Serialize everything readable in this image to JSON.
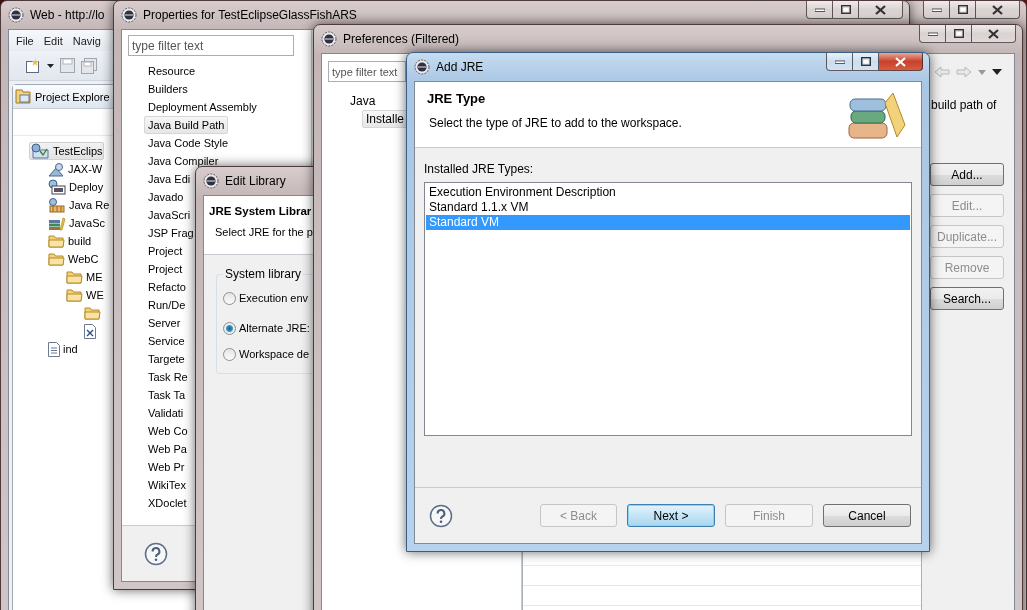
{
  "main_window": {
    "title": "Web - http://lo",
    "menu": [
      "File",
      "Edit",
      "Navig"
    ],
    "view_title": "Project Explore",
    "tree": [
      {
        "label": "TestEclips",
        "kind": "project",
        "selected": true,
        "children": [
          {
            "label": "JAX-W",
            "kind": "service",
            "selected": false
          },
          {
            "label": "Deploy",
            "kind": "deploy",
            "selected": false
          },
          {
            "label": "Java Re",
            "kind": "library",
            "selected": false
          },
          {
            "label": "JavaSc",
            "kind": "jslib",
            "selected": false
          },
          {
            "label": "build",
            "kind": "folder",
            "selected": false
          },
          {
            "label": "WebC",
            "kind": "folder",
            "selected": false,
            "children": [
              {
                "label": "ME",
                "kind": "folder",
                "selected": false
              },
              {
                "label": "WE",
                "kind": "folder",
                "selected": false,
                "children": [
                  {
                    "kind": "folder",
                    "selected": false
                  },
                  {
                    "kind": "xml",
                    "selected": false
                  }
                ]
              }
            ]
          },
          {
            "label": "ind",
            "kind": "file",
            "selected": false
          }
        ]
      }
    ]
  },
  "properties_window": {
    "title": "Properties for TestEclipseGlassFishARS",
    "filter_placeholder": "type filter text",
    "pages": [
      {
        "label": "Resource",
        "selected": false
      },
      {
        "label": "Builders",
        "selected": false
      },
      {
        "label": "Deployment Assembly",
        "selected": false
      },
      {
        "label": "Java Build Path",
        "selected": true
      },
      {
        "label": "Java Code Style",
        "selected": false
      },
      {
        "label": "Java Compiler",
        "selected": false
      },
      {
        "label": "Java Edi",
        "selected": false
      },
      {
        "label": "Javado",
        "selected": false
      },
      {
        "label": "JavaScri",
        "selected": false
      },
      {
        "label": "JSP Frag",
        "selected": false
      },
      {
        "label": "Project",
        "selected": false
      },
      {
        "label": "Project",
        "selected": false
      },
      {
        "label": "Refacto",
        "selected": false
      },
      {
        "label": "Run/De",
        "selected": false
      },
      {
        "label": "Server",
        "selected": false
      },
      {
        "label": "Service",
        "selected": false
      },
      {
        "label": "Targete",
        "selected": false
      },
      {
        "label": "Task Re",
        "selected": false
      },
      {
        "label": "Task Ta",
        "selected": false
      },
      {
        "label": "Validati",
        "selected": false
      },
      {
        "label": "Web Co",
        "selected": false
      },
      {
        "label": "Web Pa",
        "selected": false
      },
      {
        "label": "Web Pr",
        "selected": false
      },
      {
        "label": "WikiTex",
        "selected": false
      },
      {
        "label": "XDoclet",
        "selected": false
      }
    ]
  },
  "edit_library": {
    "title": "Edit Library",
    "heading": "JRE System Librar",
    "description": "Select JRE for the p",
    "group_label": "System library",
    "options": [
      {
        "label": "Execution env",
        "selected": false
      },
      {
        "label": "Alternate JRE:",
        "selected": true
      },
      {
        "label": "Workspace de",
        "selected": false
      }
    ]
  },
  "preferences": {
    "title": "Preferences (Filtered)",
    "filter_placeholder": "type filter text",
    "tree": [
      {
        "label": "Java",
        "selected": false,
        "children": [
          {
            "label": "Installe",
            "selected": true
          }
        ]
      }
    ],
    "description": "build path of",
    "buttons": [
      {
        "label": "Add...",
        "disabled": false
      },
      {
        "label": "Edit...",
        "disabled": true
      },
      {
        "label": "Duplicate...",
        "disabled": true
      },
      {
        "label": "Remove",
        "disabled": true
      },
      {
        "label": "Search...",
        "disabled": false
      }
    ]
  },
  "add_jre": {
    "title": "Add JRE",
    "heading": "JRE Type",
    "description": "Select the type of JRE to add to the workspace.",
    "list_label": "Installed JRE Types:",
    "jre_types": [
      {
        "label": "Execution Environment Description",
        "selected": false
      },
      {
        "label": "Standard 1.1.x VM",
        "selected": false
      },
      {
        "label": "Standard VM",
        "selected": true
      }
    ],
    "buttons": [
      {
        "label": "< Back",
        "disabled": true,
        "default": false
      },
      {
        "label": "Next >",
        "disabled": false,
        "default": true
      },
      {
        "label": "Finish",
        "disabled": true,
        "default": false
      },
      {
        "label": "Cancel",
        "disabled": false,
        "default": false
      }
    ]
  }
}
